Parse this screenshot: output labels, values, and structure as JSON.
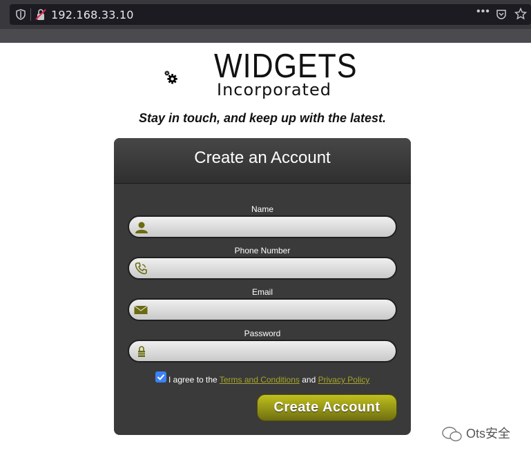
{
  "browser": {
    "url": "192.168.33.10",
    "icons": [
      "shield-icon",
      "insecure-lock-icon",
      "more-dots-icon",
      "pocket-icon",
      "star-icon"
    ]
  },
  "logo": {
    "title": "WIDGETS",
    "subtitle": "Incorporated"
  },
  "tagline": "Stay in touch, and keep up with the latest.",
  "form": {
    "title": "Create an Account",
    "fields": [
      {
        "label": "Name",
        "value": "",
        "icon": "user-icon"
      },
      {
        "label": "Phone Number",
        "value": "",
        "icon": "phone-icon"
      },
      {
        "label": "Email",
        "value": "",
        "icon": "envelope-icon"
      },
      {
        "label": "Password",
        "value": "",
        "icon": "lock-icon"
      }
    ],
    "agree": {
      "checked": true,
      "prefix": "I agree to the",
      "terms_link": "Terms and Conditions",
      "and": "and",
      "privacy_link": "Privacy Policy"
    },
    "submit_label": "Create Account"
  },
  "watermark": "Ots安全",
  "colors": {
    "accent": "#a5a52a",
    "panel": "#3a3a3a",
    "checkbox": "#3b82f6"
  }
}
